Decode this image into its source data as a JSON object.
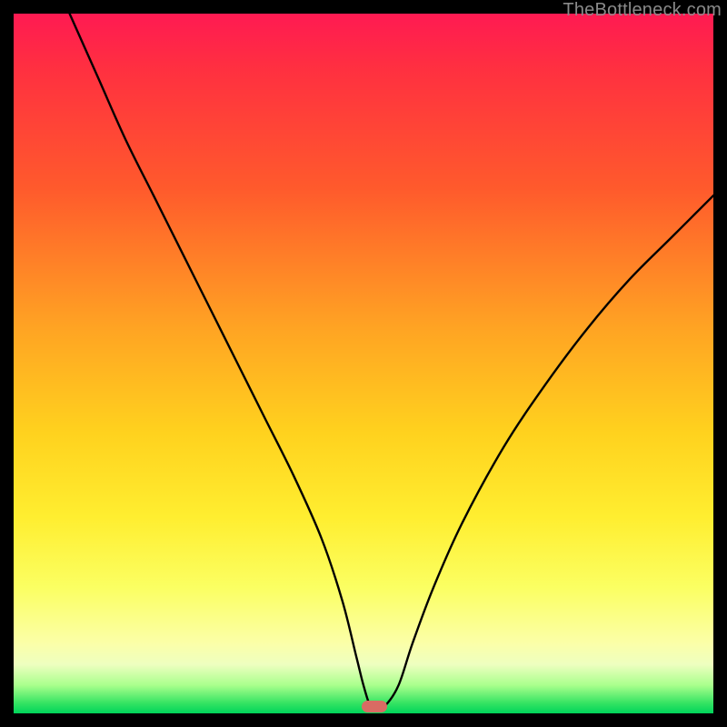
{
  "watermark": {
    "text": "TheBottleneck.com"
  },
  "colors": {
    "curve_stroke": "#000000",
    "marker_fill": "#d96b63",
    "page_bg": "#000000"
  },
  "chart_data": {
    "type": "line",
    "title": "",
    "xlabel": "",
    "ylabel": "",
    "xlim": [
      0,
      100
    ],
    "ylim": [
      0,
      100
    ],
    "grid": false,
    "legend": false,
    "annotations": [
      "TheBottleneck.com"
    ],
    "series": [
      {
        "name": "bottleneck-curve",
        "x": [
          8,
          12,
          16,
          20,
          24,
          28,
          32,
          36,
          40,
          44,
          47,
          49,
          50,
          51,
          52,
          53,
          55,
          57,
          60,
          64,
          70,
          76,
          82,
          88,
          94,
          100
        ],
        "values": [
          100,
          91,
          82,
          74,
          66,
          58,
          50,
          42,
          34,
          25,
          16,
          8,
          4,
          1,
          1,
          1,
          4,
          10,
          18,
          27,
          38,
          47,
          55,
          62,
          68,
          74
        ]
      }
    ],
    "marker": {
      "x": 51.5,
      "y": 1,
      "shape": "pill"
    },
    "gradient_stops": [
      {
        "pos": 0.0,
        "color": "#ff1a52"
      },
      {
        "pos": 0.25,
        "color": "#ff5a2c"
      },
      {
        "pos": 0.6,
        "color": "#ffd21e"
      },
      {
        "pos": 0.9,
        "color": "#fbffa8"
      },
      {
        "pos": 1.0,
        "color": "#00d45a"
      }
    ]
  }
}
